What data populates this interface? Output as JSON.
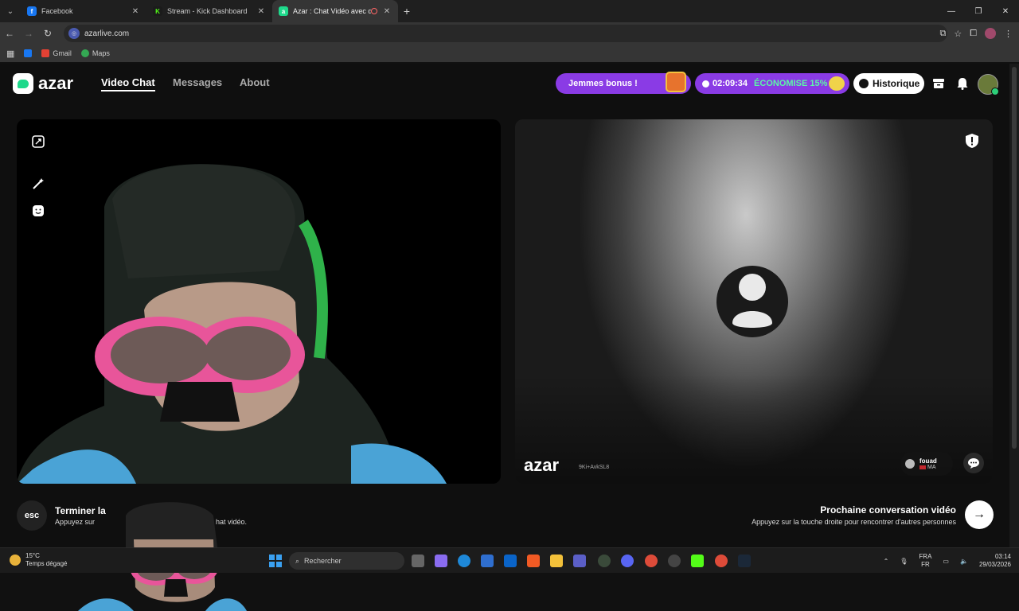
{
  "browser": {
    "tabs": [
      {
        "title": "Facebook",
        "fav_color": "#1877f2",
        "fav_glyph": "f"
      },
      {
        "title": "Stream - Kick Dashboard",
        "fav_color": "#1b1b1b",
        "fav_glyph": "K"
      },
      {
        "title": "Azar : Chat Vidéo avec de n",
        "fav_color": "#1ed98b",
        "fav_glyph": "a"
      }
    ],
    "url": "azarlive.com",
    "bookmarks": [
      {
        "label": "",
        "color": "#1877f2"
      },
      {
        "label": "Gmail",
        "color": "#e44134"
      },
      {
        "label": "Maps",
        "color": "#34a853"
      }
    ]
  },
  "site": {
    "logo_text": "azar",
    "nav": {
      "video_chat": "Video Chat",
      "messages": "Messages",
      "about": "About"
    },
    "bonus_label": "Jemmes bonus !",
    "timer": "02:09:34",
    "save_label": "ÉCONOMISE 15%",
    "history_label": "Historique",
    "watermark": "azar",
    "watermark_id": "9Ki+AvkSL8",
    "peer": {
      "name": "fouad",
      "country": "MA"
    },
    "end": {
      "key": "esc",
      "title": "Terminer la",
      "subtitle": "Appuyez sur",
      "subtitle_tail": "hat vidéo."
    },
    "next": {
      "title": "Prochaine conversation vidéo",
      "subtitle": "Appuyez sur la touche droite pour rencontrer d'autres personnes"
    }
  },
  "taskbar": {
    "temp": "15°C",
    "weather": "Temps dégagé",
    "search_placeholder": "Rechercher",
    "lang_top": "FRA",
    "lang_bottom": "FR",
    "time": "03:14",
    "date": "29/03/2026"
  },
  "colors": {
    "brand_green": "#1ed98b",
    "promo_purple": "#8a3be5",
    "promo_green": "#5cf7a7"
  }
}
